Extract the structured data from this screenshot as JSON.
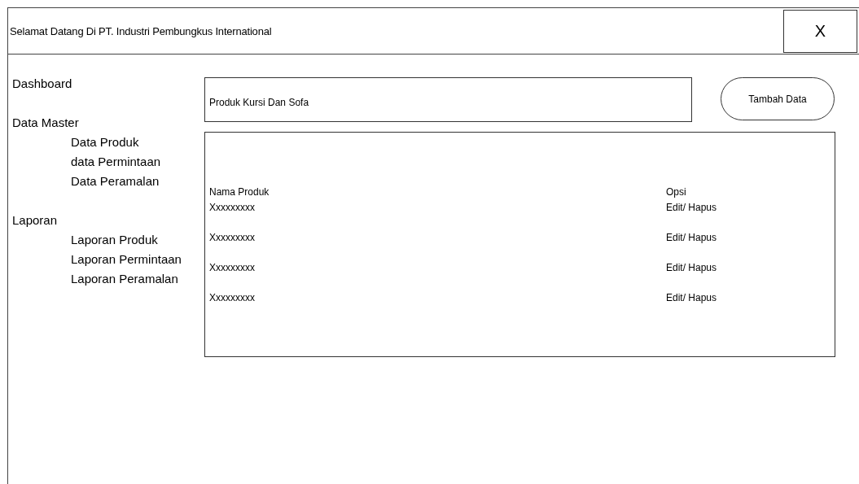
{
  "window": {
    "title": "Selamat Datang Di PT. Industri Pembungkus International",
    "close_label": "X"
  },
  "sidebar": {
    "items": [
      {
        "label": "Dashboard"
      },
      {
        "label": "Data Master",
        "children": [
          {
            "label": "Data Produk"
          },
          {
            "label": "data Permintaan"
          },
          {
            "label": "Data Peramalan"
          }
        ]
      },
      {
        "label": "Laporan",
        "children": [
          {
            "label": "Laporan Produk"
          },
          {
            "label": "Laporan Permintaan"
          },
          {
            "label": "Laporan Peramalan"
          }
        ]
      }
    ]
  },
  "content": {
    "title_field": {
      "value": "Produk Kursi Dan Sofa"
    },
    "add_button": "Tambah Data",
    "table": {
      "columns": [
        "Nama Produk",
        "Opsi"
      ],
      "rows": [
        [
          "Xxxxxxxxx",
          "Edit/ Hapus"
        ],
        [
          "Xxxxxxxxx",
          "Edit/ Hapus"
        ],
        [
          "Xxxxxxxxx",
          "Edit/ Hapus"
        ],
        [
          "Xxxxxxxxx",
          "Edit/ Hapus"
        ]
      ]
    }
  }
}
